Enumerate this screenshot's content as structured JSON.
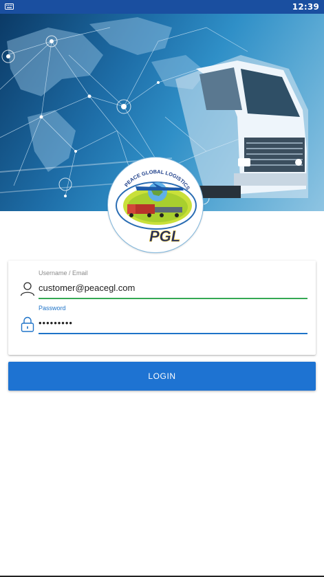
{
  "status_bar": {
    "time": "12:39",
    "left_icon": "keyboard-icon",
    "background": "#1a4fa0"
  },
  "hero": {
    "description_icon": "truck-world-map-image"
  },
  "logo": {
    "ring_text": "PEACE GLOBAL LOGISTICS",
    "initials": "PGL"
  },
  "login_form": {
    "email": {
      "label": "Username / Email",
      "value": "customer@peacegl.com",
      "icon": "user-icon",
      "underline_color": "#34a853"
    },
    "password": {
      "label": "Password",
      "value": "•••••••••",
      "icon": "lock-icon",
      "underline_color": "#1e73c8"
    },
    "submit_label": "LOGIN",
    "submit_color": "#1e73d2"
  }
}
